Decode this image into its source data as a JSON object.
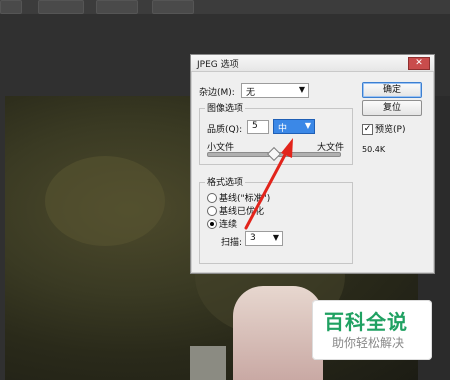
{
  "dialog": {
    "title": "JPEG 选项",
    "matte_label": "杂边(M):",
    "matte_value": "无",
    "image_options_title": "图像选项",
    "quality_label": "品质(Q):",
    "quality_value": "5",
    "quality_level": "中",
    "slider_left": "小文件",
    "slider_right": "大文件",
    "slider_fraction": 0.5,
    "format_title": "格式选项",
    "format_options": [
      "基线(\"标准\")",
      "基线已优化",
      "连续"
    ],
    "scans_label": "扫描:",
    "scans_value": "3",
    "ok_label": "确定",
    "reset_label": "复位",
    "preview_label": "预览(P)",
    "preview_checked": true,
    "file_size": "50.4K"
  },
  "watermark": {
    "title": "百科全说",
    "subtitle": "助你轻松解决"
  },
  "icons": {
    "close": "close-icon",
    "dropdown": "chevron-down-icon",
    "check": "check-icon",
    "arrow": "annotation-arrow-icon"
  }
}
